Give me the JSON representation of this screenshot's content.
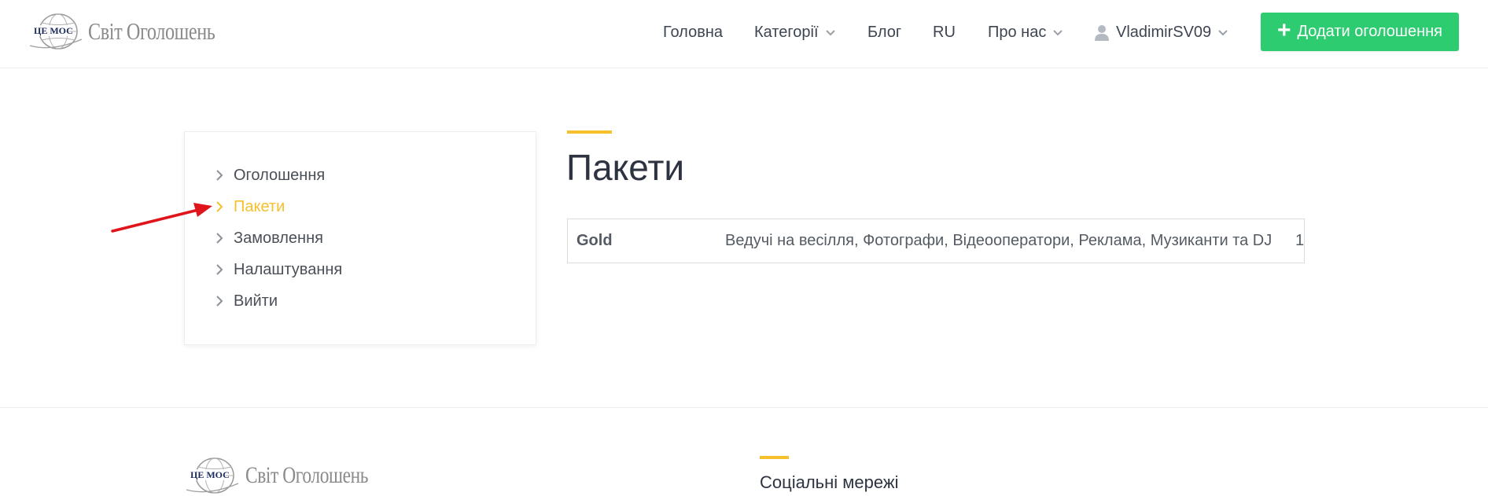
{
  "logo": {
    "text": "Світ Оголошень",
    "emblem_text": "ЦЕ МОС"
  },
  "nav": {
    "home": "Головна",
    "categories": "Категорії",
    "blog": "Блог",
    "lang": "RU",
    "about": "Про нас",
    "user": "VladimirSV09"
  },
  "add_button": {
    "label": "Додати оголошення"
  },
  "sidebar": {
    "items": [
      {
        "label": "Оголошення"
      },
      {
        "label": "Пакети"
      },
      {
        "label": "Замовлення"
      },
      {
        "label": "Налаштування"
      },
      {
        "label": "Вийти"
      }
    ],
    "active_index": 1
  },
  "main": {
    "title": "Пакети",
    "packages": [
      {
        "name": "Gold",
        "categories": "Ведучі на весілля, Фотографи, Відеооператори, Реклама, Музиканти та DJ",
        "count": "1"
      }
    ]
  },
  "footer": {
    "logo_text": "Світ Оголошень",
    "social_title": "Соціальні мережі"
  },
  "colors": {
    "accent": "#f5c02c",
    "button": "#2ecc71",
    "annotation": "#e0141b"
  }
}
